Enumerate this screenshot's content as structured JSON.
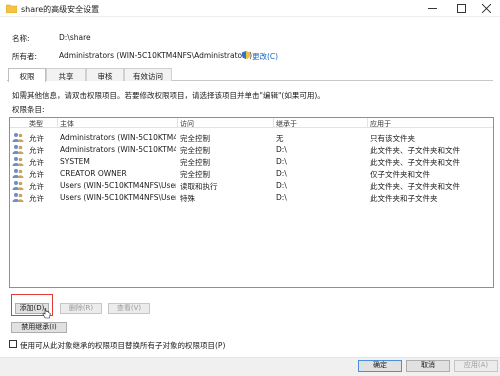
{
  "window": {
    "title": "share的高级安全设置",
    "minimize_icon": "minimize-icon",
    "maximize_icon": "maximize-icon",
    "close_icon": "close-icon"
  },
  "info": {
    "name_label": "名称:",
    "name_value": "D:\\share",
    "owner_label": "所有者:",
    "owner_value": "Administrators (WIN-5C10KTM4NFS\\Administrators)",
    "change_link": "更改(C)"
  },
  "tabs": [
    {
      "label": "权限",
      "active": true
    },
    {
      "label": "共享",
      "active": false
    },
    {
      "label": "审核",
      "active": false
    },
    {
      "label": "有效访问",
      "active": false
    }
  ],
  "instruction": "如需其他信息，请双击权限项目。若要修改权限项目，请选择该项目并单击\"编辑\"(如果可用)。",
  "entries_label": "权限条目:",
  "table": {
    "columns": [
      "类型",
      "主体",
      "访问",
      "继承于",
      "应用于"
    ],
    "rows": [
      {
        "type": "允许",
        "principal": "Administrators (WIN-5C10KTM4...",
        "access": "完全控制",
        "inherited": "无",
        "applies": "只有该文件夹"
      },
      {
        "type": "允许",
        "principal": "Administrators (WIN-5C10KTM4...",
        "access": "完全控制",
        "inherited": "D:\\",
        "applies": "此文件夹、子文件夹和文件"
      },
      {
        "type": "允许",
        "principal": "SYSTEM",
        "access": "完全控制",
        "inherited": "D:\\",
        "applies": "此文件夹、子文件夹和文件"
      },
      {
        "type": "允许",
        "principal": "CREATOR OWNER",
        "access": "完全控制",
        "inherited": "D:\\",
        "applies": "仅子文件夹和文件"
      },
      {
        "type": "允许",
        "principal": "Users (WIN-5C10KTM4NFS\\User...",
        "access": "读取和执行",
        "inherited": "D:\\",
        "applies": "此文件夹、子文件夹和文件"
      },
      {
        "type": "允许",
        "principal": "Users (WIN-5C10KTM4NFS\\User...",
        "access": "特殊",
        "inherited": "D:\\",
        "applies": "此文件夹和子文件夹"
      }
    ]
  },
  "buttons": {
    "add": "添加(D)",
    "remove": "删除(R)",
    "view": "查看(V)",
    "disable_inheritance": "禁用继承(I)"
  },
  "checkbox_label": "使用可从此对象继承的权限项目替换所有子对象的权限项目(P)",
  "footer": {
    "ok": "确定",
    "cancel": "取消",
    "apply": "应用(A)"
  },
  "colors": {
    "link": "#1565c0",
    "highlight": "#e53935",
    "folder": "#f6c244"
  }
}
